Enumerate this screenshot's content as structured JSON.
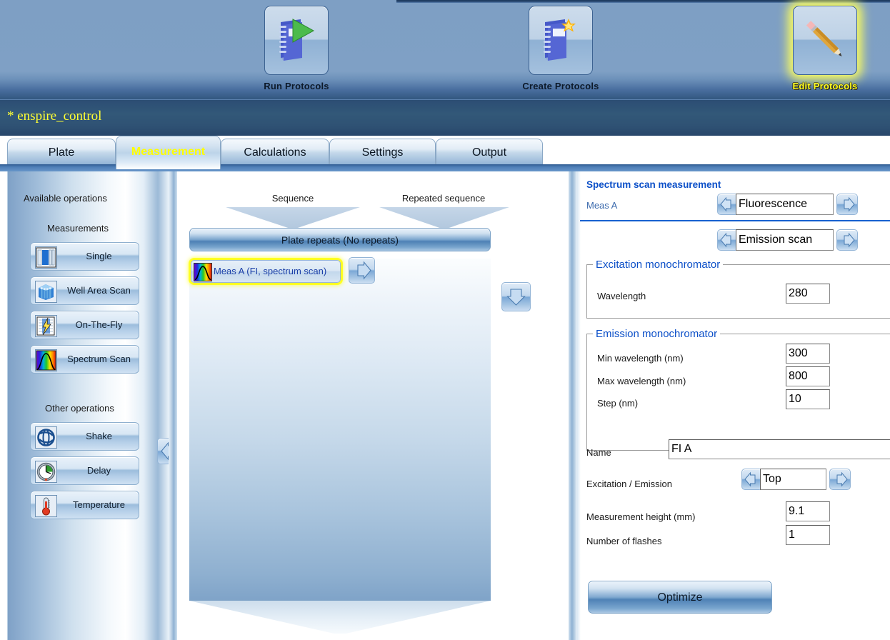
{
  "toolbar": {
    "items": [
      {
        "label": "Run Protocols",
        "icon": "book-play-icon",
        "selected": false
      },
      {
        "label": "Create Protocols",
        "icon": "book-star-icon",
        "selected": false
      },
      {
        "label": "Edit Protocols",
        "icon": "pencil-icon",
        "selected": true
      }
    ]
  },
  "titlebar": {
    "protocol_name": "* enspire_control"
  },
  "tabs": [
    {
      "label": "Plate",
      "active": false
    },
    {
      "label": "Measurement",
      "active": true
    },
    {
      "label": "Calculations",
      "active": false
    },
    {
      "label": "Settings",
      "active": false
    },
    {
      "label": "Output",
      "active": false
    }
  ],
  "sidebar": {
    "title": "Available operations",
    "group_measurements_label": "Measurements",
    "measurements": [
      {
        "label": "Single",
        "icon": "single-well-icon"
      },
      {
        "label": "Well Area Scan",
        "icon": "well-area-scan-icon"
      },
      {
        "label": "On-The-Fly",
        "icon": "on-the-fly-icon"
      },
      {
        "label": "Spectrum Scan",
        "icon": "spectrum-scan-icon"
      }
    ],
    "group_other_label": "Other operations",
    "other": [
      {
        "label": "Shake",
        "icon": "shake-icon"
      },
      {
        "label": "Delay",
        "icon": "clock-icon"
      },
      {
        "label": "Temperature",
        "icon": "thermometer-icon"
      }
    ],
    "move_left_button": "move-operation-left"
  },
  "center": {
    "sequence_label": "Sequence",
    "repeated_sequence_label": "Repeated sequence",
    "plate_repeats_label": "Plate repeats (No repeats)",
    "steps": [
      {
        "label": "Meas A (FI, spectrum scan)",
        "icon": "spectrum-scan-icon",
        "selected": true
      }
    ],
    "add_button": "move-operation-right",
    "down_button": "move-step-down"
  },
  "right": {
    "title": "Spectrum scan measurement",
    "meas_caption": "Meas A",
    "technology": {
      "value": "Fluorescence",
      "prev": "◀",
      "next": "▶"
    },
    "scan_type": {
      "value": "Emission scan",
      "prev": "◀",
      "next": "▶"
    },
    "excitation_group": {
      "legend": "Excitation monochromator",
      "fields": [
        {
          "label": "Wavelength",
          "value": "280"
        }
      ]
    },
    "emission_group": {
      "legend": "Emission monochromator",
      "fields": [
        {
          "label": "Min wavelength (nm)",
          "value": "300"
        },
        {
          "label": "Max wavelength (nm)",
          "value": "800"
        },
        {
          "label": "Step (nm)",
          "value": "10"
        }
      ]
    },
    "name_label": "Name",
    "name_value": "FI A",
    "exc_emi_label": "Excitation / Emission",
    "exc_emi_value": "Top",
    "height_label": "Measurement height (mm)",
    "height_value": "9.1",
    "flashes_label": "Number of flashes",
    "flashes_value": "1",
    "optimize_label": "Optimize"
  },
  "colors": {
    "accent_blue": "#0b4fc8",
    "highlight_yellow": "#ffff00",
    "toolbar_bg": "#7fa0c5",
    "titlebar_bg": "#2f5274",
    "tab_active_text": "#ffff00"
  }
}
